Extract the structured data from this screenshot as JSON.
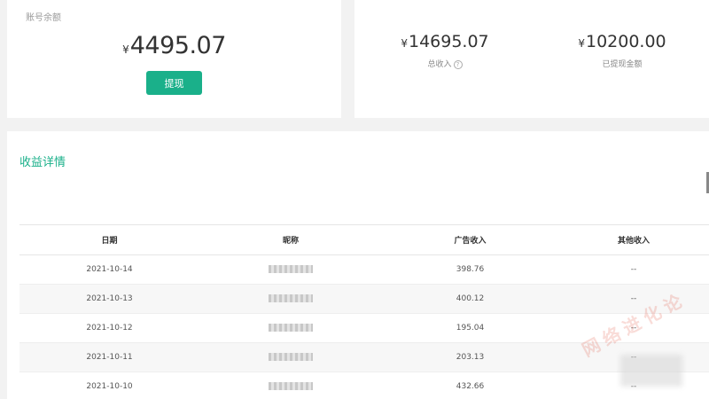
{
  "balance": {
    "label": "账号余额",
    "currency": "¥",
    "amount": "4495.07",
    "withdraw_label": "提现"
  },
  "income": {
    "total": {
      "currency": "¥",
      "amount": "14695.07",
      "label": "总收入"
    },
    "withdrawn": {
      "currency": "¥",
      "amount": "10200.00",
      "label": "已提现金额"
    }
  },
  "details": {
    "title": "收益详情",
    "columns": [
      "日期",
      "昵称",
      "广告收入",
      "其他收入"
    ],
    "rows": [
      {
        "date": "2021-10-14",
        "ad_income": "398.76",
        "other_income": "--"
      },
      {
        "date": "2021-10-13",
        "ad_income": "400.12",
        "other_income": "--"
      },
      {
        "date": "2021-10-12",
        "ad_income": "195.04",
        "other_income": "--"
      },
      {
        "date": "2021-10-11",
        "ad_income": "203.13",
        "other_income": "--"
      },
      {
        "date": "2021-10-10",
        "ad_income": "432.66",
        "other_income": "--"
      }
    ]
  },
  "watermark": {
    "text": "网络进化论"
  },
  "colors": {
    "accent": "#1ab08a",
    "background": "#f2f2f2"
  },
  "icons": {
    "help": "question-circle-icon"
  }
}
